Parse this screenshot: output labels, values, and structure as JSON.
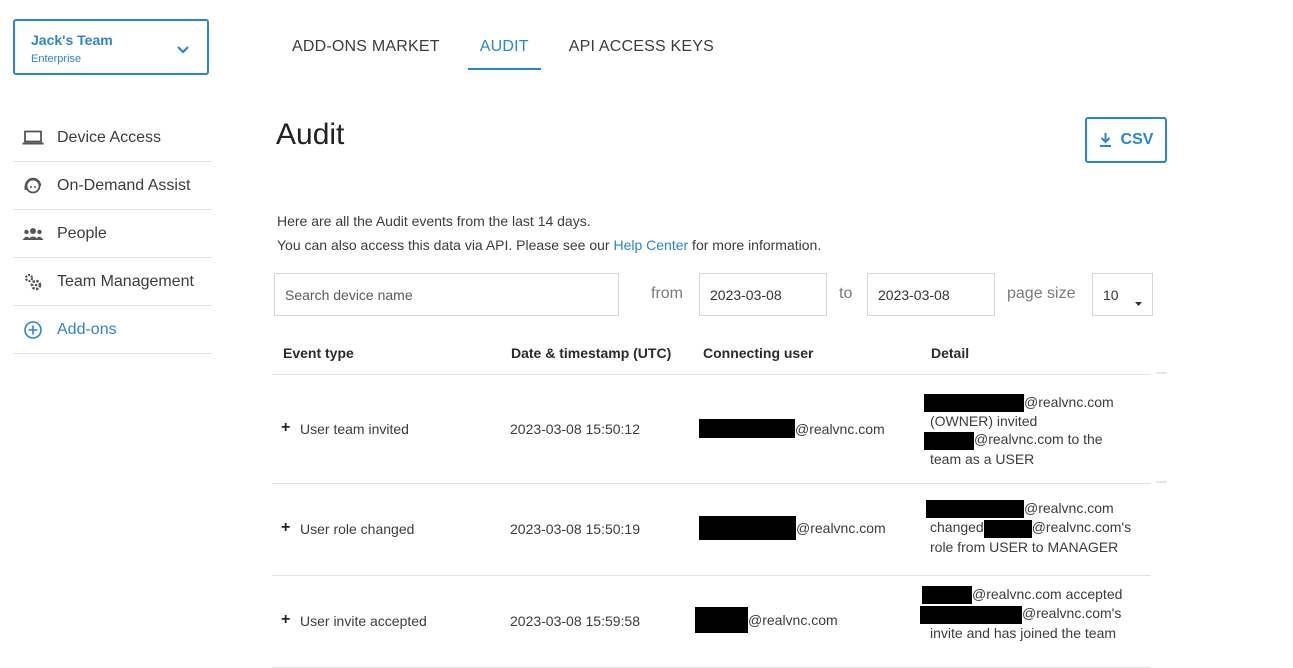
{
  "team": {
    "name": "Jack's Team",
    "plan": "Enterprise"
  },
  "sidebar": {
    "items": [
      {
        "label": "Device Access",
        "icon": "laptop-icon"
      },
      {
        "label": "On-Demand Assist",
        "icon": "support-agent-icon"
      },
      {
        "label": "People",
        "icon": "people-icon"
      },
      {
        "label": "Team Management",
        "icon": "gears-icon"
      },
      {
        "label": "Add-ons",
        "icon": "add-circle-icon"
      }
    ],
    "active_index": 4
  },
  "tabs": [
    {
      "label": "ADD-ONS MARKET"
    },
    {
      "label": "AUDIT"
    },
    {
      "label": "API ACCESS KEYS"
    }
  ],
  "active_tab": "AUDIT",
  "page": {
    "title": "Audit",
    "csv_label": "CSV",
    "intro_line1": "Here are all the Audit events from the last 14 days.",
    "intro_line2_pre": "You can also access this data via API. Please see our ",
    "intro_link": "Help Center",
    "intro_line2_post": " for more information."
  },
  "filters": {
    "search_placeholder": "Search device name",
    "from_label": "from",
    "from_value": "2023-03-08",
    "to_label": "to",
    "to_value": "2023-03-08",
    "page_size_label": "page size",
    "page_size_value": "10"
  },
  "table": {
    "headers": [
      "Event type",
      "Date & timestamp (UTC)",
      "Connecting user",
      "Detail"
    ],
    "rows": [
      {
        "event": "User team invited",
        "timestamp": "2023-03-08 15:50:12",
        "user_domain": "@realvnc.com",
        "detail": [
          "@realvnc.com",
          "(OWNER) invited",
          "@realvnc.com to the",
          "team as a USER"
        ]
      },
      {
        "event": "User role changed",
        "timestamp": "2023-03-08 15:50:19",
        "user_domain": "@realvnc.com",
        "detail": [
          "@realvnc.com",
          "changed",
          "@realvnc.com's",
          "role from USER to MANAGER"
        ]
      },
      {
        "event": "User invite accepted",
        "timestamp": "2023-03-08 15:59:58",
        "user_domain": "@realvnc.com",
        "detail": [
          "@realvnc.com accepted",
          "@realvnc.com's",
          "invite and has joined the team"
        ]
      }
    ]
  },
  "colors": {
    "accent": "#2a87c9",
    "text": "#3c3c3c",
    "border": "#e3e3e3",
    "redaction": "#000000"
  }
}
